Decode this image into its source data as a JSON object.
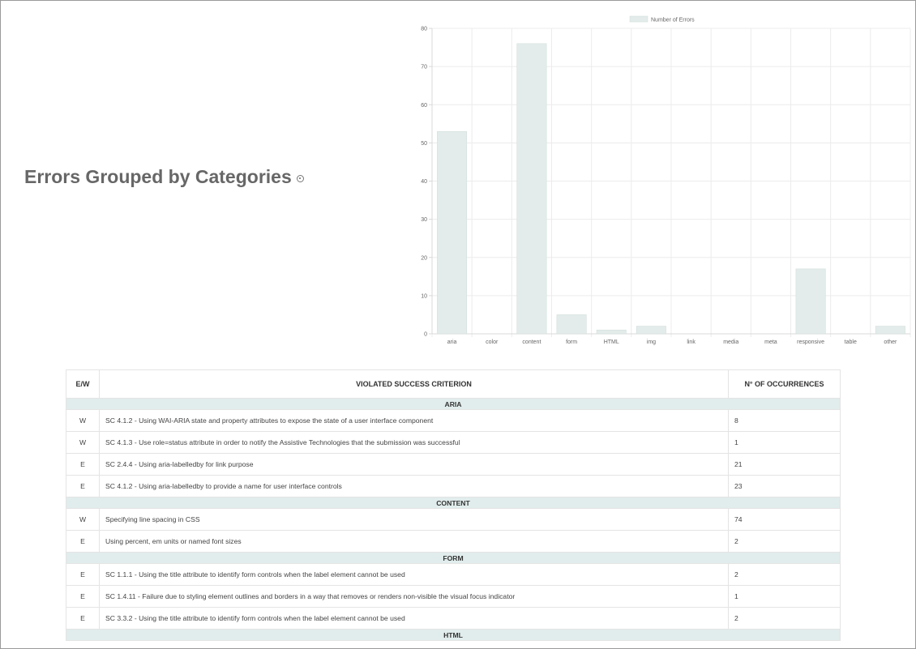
{
  "section": {
    "title": "Errors Grouped by Categories",
    "info_icon": "info-circle-icon"
  },
  "chart_data": {
    "type": "bar",
    "categories": [
      "aria",
      "color",
      "content",
      "form",
      "HTML",
      "img",
      "link",
      "media",
      "meta",
      "responsive",
      "table",
      "other"
    ],
    "series": [
      {
        "name": "Number of Errors",
        "values": [
          53,
          0,
          76,
          5,
          1,
          2,
          0,
          0,
          0,
          17,
          0,
          2
        ]
      }
    ],
    "ylim": [
      0,
      80
    ],
    "yticks": [
      0,
      10,
      20,
      30,
      40,
      50,
      60,
      70,
      80
    ],
    "grid": true,
    "legend": "top-center",
    "bar_color": "#e3ecea",
    "bar_border": "#d3dfdc"
  },
  "table": {
    "headers": [
      "E/W",
      "VIOLATED SUCCESS CRITERION",
      "N° OF OCCURRENCES"
    ],
    "groups": [
      {
        "name": "ARIA",
        "rows": [
          {
            "ew": "W",
            "criterion": "SC 4.1.2 - Using WAI-ARIA state and property attributes to expose the state of a user interface component",
            "count": "8"
          },
          {
            "ew": "W",
            "criterion": "SC 4.1.3 - Use role=status attribute in order to notify the Assistive Technologies that the submission was successful",
            "count": "1"
          },
          {
            "ew": "E",
            "criterion": "SC 2.4.4 - Using aria-labelledby for link purpose",
            "count": "21"
          },
          {
            "ew": "E",
            "criterion": "SC 4.1.2 - Using aria-labelledby to provide a name for user interface controls",
            "count": "23"
          }
        ]
      },
      {
        "name": "CONTENT",
        "rows": [
          {
            "ew": "W",
            "criterion": "Specifying line spacing in CSS",
            "count": "74"
          },
          {
            "ew": "E",
            "criterion": "Using percent, em units or named font sizes",
            "count": "2"
          }
        ]
      },
      {
        "name": "FORM",
        "rows": [
          {
            "ew": "E",
            "criterion": "SC 1.1.1 - Using the title attribute to identify form controls when the label element cannot be used",
            "count": "2"
          },
          {
            "ew": "E",
            "criterion": "SC 1.4.11 - Failure due to styling element outlines and borders in a way that removes or renders non-visible the visual focus indicator",
            "count": "1"
          },
          {
            "ew": "E",
            "criterion": "SC 3.3.2 - Using the title attribute to identify form controls when the label element cannot be used",
            "count": "2"
          }
        ]
      },
      {
        "name": "HTML",
        "rows": []
      }
    ]
  }
}
